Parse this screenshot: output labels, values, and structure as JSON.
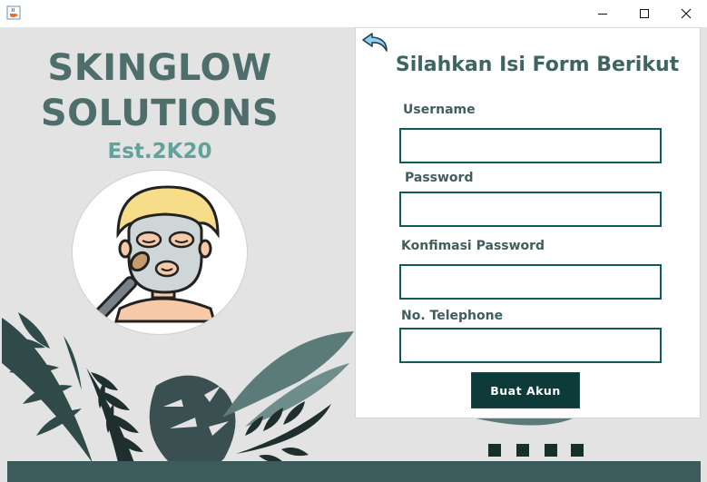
{
  "window": {
    "app_icon": "java-cup-icon",
    "controls": [
      "minimize-icon",
      "maximize-icon",
      "close-icon"
    ]
  },
  "brand": {
    "line1": "SKINGLOW",
    "line2": "SOLUTIONS",
    "established": "Est.2K20",
    "logo_icon": "face-mask-icon"
  },
  "form": {
    "back_icon": "back-arrow-icon",
    "title": "Silahkan Isi Form Berikut",
    "fields": [
      {
        "label": "Username",
        "value": ""
      },
      {
        "label": "Password",
        "value": ""
      },
      {
        "label": "Konfimasi Password",
        "value": ""
      },
      {
        "label": "No. Telephone",
        "value": ""
      }
    ],
    "submit_label": "Buat Akun"
  },
  "colors": {
    "brand_dark": "#4e6e6c",
    "brand_accent": "#5fa39c",
    "button_bg": "#0e3a3a",
    "input_border": "#0e5b58",
    "background": "#e3e3e3"
  }
}
